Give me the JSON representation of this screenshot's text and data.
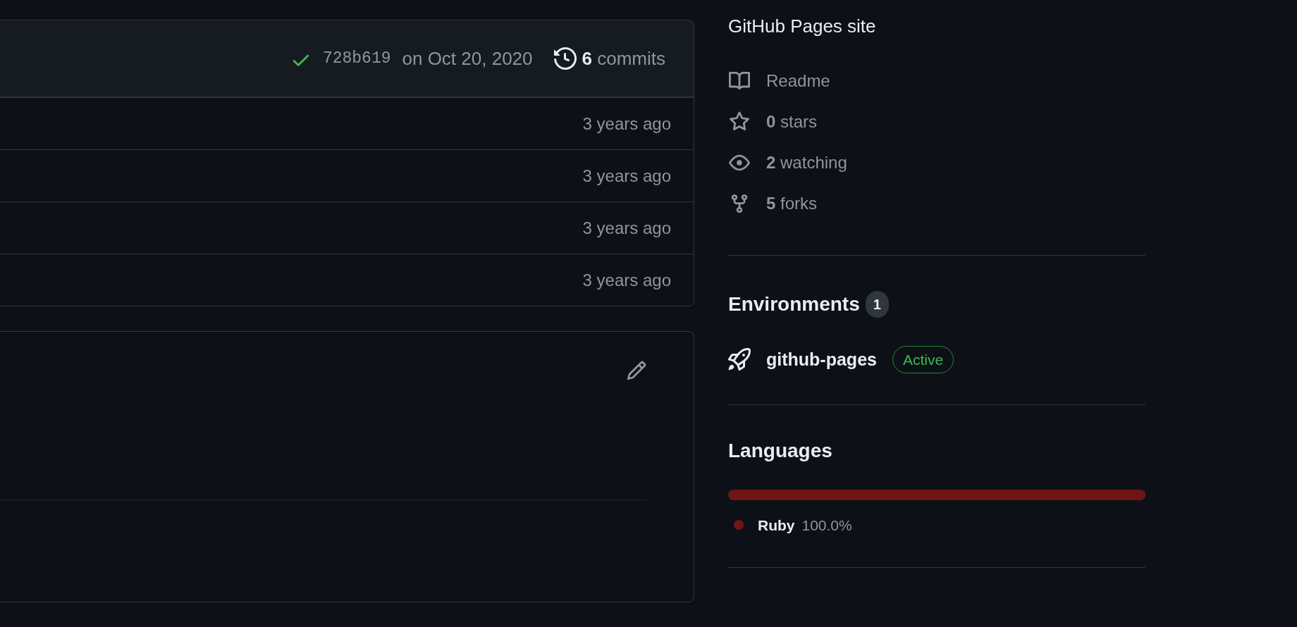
{
  "latest_commit": {
    "checks_passed": true,
    "hash": "728b619",
    "date": "on Oct 20, 2020",
    "commits_count": "6",
    "commits_label": "commits"
  },
  "file_rows": [
    {
      "age": "3 years ago"
    },
    {
      "age": "3 years ago"
    },
    {
      "age": "3 years ago"
    },
    {
      "age": "3 years ago"
    }
  ],
  "readme_box": {
    "editable": true
  },
  "sidebar": {
    "about_text": "GitHub Pages site",
    "links": [
      {
        "kind": "readme",
        "text": "Readme"
      },
      {
        "kind": "stars",
        "text": "**0** stars"
      },
      {
        "kind": "watching",
        "text": "**2** watching"
      },
      {
        "kind": "forks",
        "text": "**5** forks"
      }
    ],
    "environments": {
      "title": "Environments",
      "count": "1",
      "items": [
        {
          "name": "github-pages",
          "status": "Active"
        }
      ]
    },
    "languages": {
      "title": "Languages",
      "items": [
        {
          "name": "Ruby",
          "percent": "100.0%",
          "level": 1.0,
          "color": "#701516"
        }
      ]
    }
  }
}
